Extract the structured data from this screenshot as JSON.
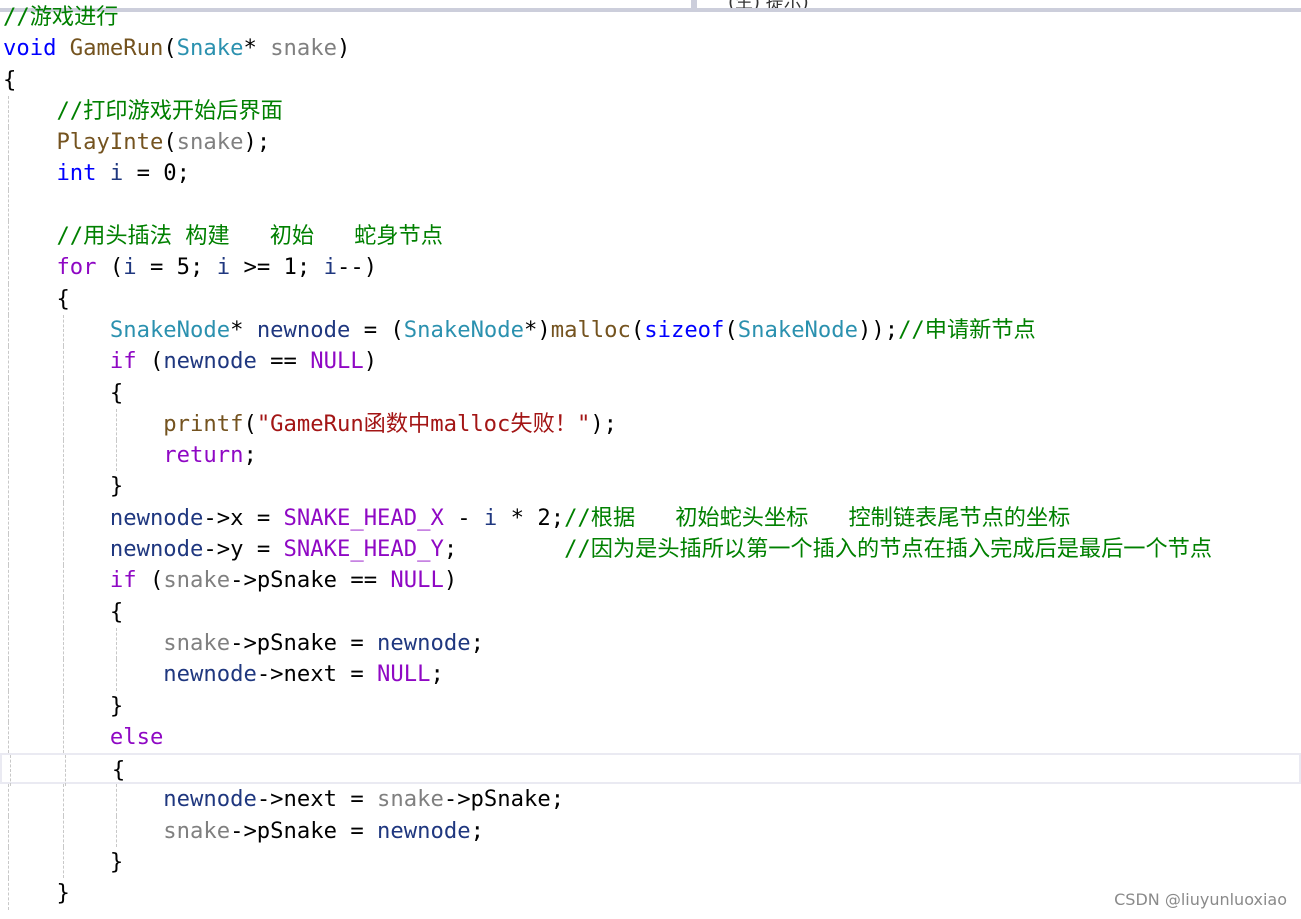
{
  "window": {
    "top_partial_text": "(生) 提示)"
  },
  "colors": {
    "keyword": "#0000ff",
    "control": "#8f08c4",
    "type": "#2b91af",
    "function": "#74531f",
    "parameter": "#808080",
    "local": "#1f377f",
    "comment": "#008000",
    "string": "#a31515"
  },
  "current_line": 24,
  "code": [
    {
      "indent": 0,
      "tokens": [
        [
          "//游戏进行",
          "c"
        ]
      ]
    },
    {
      "indent": 0,
      "tokens": [
        [
          "void",
          "k"
        ],
        [
          " ",
          "d"
        ],
        [
          "GameRun",
          "f"
        ],
        [
          "(",
          "d"
        ],
        [
          "Snake",
          "t"
        ],
        [
          "* ",
          "d"
        ],
        [
          "snake",
          "g"
        ],
        [
          ")",
          "d"
        ]
      ]
    },
    {
      "indent": 0,
      "tokens": [
        [
          "{",
          "d"
        ]
      ]
    },
    {
      "indent": 1,
      "tokens": [
        [
          "//打印游戏开始后界面",
          "c"
        ]
      ]
    },
    {
      "indent": 1,
      "tokens": [
        [
          "PlayInte",
          "f"
        ],
        [
          "(",
          "d"
        ],
        [
          "snake",
          "g"
        ],
        [
          ");",
          "d"
        ]
      ]
    },
    {
      "indent": 1,
      "tokens": [
        [
          "int",
          "k"
        ],
        [
          " ",
          "d"
        ],
        [
          "i",
          "v"
        ],
        [
          " = 0;",
          "d"
        ]
      ]
    },
    {
      "indent": 1,
      "tokens": []
    },
    {
      "indent": 1,
      "tokens": [
        [
          "//用头插法 构建   初始   蛇身节点",
          "c"
        ]
      ]
    },
    {
      "indent": 1,
      "tokens": [
        [
          "for",
          "p"
        ],
        [
          " (",
          "d"
        ],
        [
          "i",
          "v"
        ],
        [
          " = 5; ",
          "d"
        ],
        [
          "i",
          "v"
        ],
        [
          " >= 1; ",
          "d"
        ],
        [
          "i",
          "v"
        ],
        [
          "--)",
          "d"
        ]
      ]
    },
    {
      "indent": 1,
      "tokens": [
        [
          "{",
          "d"
        ]
      ]
    },
    {
      "indent": 2,
      "tokens": [
        [
          "SnakeNode",
          "t"
        ],
        [
          "* ",
          "d"
        ],
        [
          "newnode",
          "v"
        ],
        [
          " = (",
          "d"
        ],
        [
          "SnakeNode",
          "t"
        ],
        [
          "*)",
          "d"
        ],
        [
          "malloc",
          "f"
        ],
        [
          "(",
          "d"
        ],
        [
          "sizeof",
          "k"
        ],
        [
          "(",
          "d"
        ],
        [
          "SnakeNode",
          "t"
        ],
        [
          "));",
          "d"
        ],
        [
          "//申请新节点",
          "c"
        ]
      ]
    },
    {
      "indent": 2,
      "tokens": [
        [
          "if",
          "p"
        ],
        [
          " (",
          "d"
        ],
        [
          "newnode",
          "v"
        ],
        [
          " == ",
          "d"
        ],
        [
          "NULL",
          "p"
        ],
        [
          ")",
          "d"
        ]
      ]
    },
    {
      "indent": 2,
      "tokens": [
        [
          "{",
          "d"
        ]
      ]
    },
    {
      "indent": 3,
      "tokens": [
        [
          "printf",
          "f"
        ],
        [
          "(",
          "d"
        ],
        [
          "\"GameRun函数中malloc失败！\"",
          "s"
        ],
        [
          ");",
          "d"
        ]
      ]
    },
    {
      "indent": 3,
      "tokens": [
        [
          "return",
          "p"
        ],
        [
          ";",
          "d"
        ]
      ]
    },
    {
      "indent": 2,
      "tokens": [
        [
          "}",
          "d"
        ]
      ]
    },
    {
      "indent": 2,
      "tokens": [
        [
          "newnode",
          "v"
        ],
        [
          "->x = ",
          "d"
        ],
        [
          "SNAKE_HEAD_X",
          "p"
        ],
        [
          " - ",
          "d"
        ],
        [
          "i",
          "v"
        ],
        [
          " * 2;",
          "d"
        ],
        [
          "//根据   初始蛇头坐标   控制链表尾节点的坐标",
          "c"
        ]
      ]
    },
    {
      "indent": 2,
      "tokens": [
        [
          "newnode",
          "v"
        ],
        [
          "->y = ",
          "d"
        ],
        [
          "SNAKE_HEAD_Y",
          "p"
        ],
        [
          ";        ",
          "d"
        ],
        [
          "//因为是头插所以第一个插入的节点在插入完成后是最后一个节点",
          "c"
        ]
      ]
    },
    {
      "indent": 2,
      "tokens": [
        [
          "if",
          "p"
        ],
        [
          " (",
          "d"
        ],
        [
          "snake",
          "g"
        ],
        [
          "->pSnake == ",
          "d"
        ],
        [
          "NULL",
          "p"
        ],
        [
          ")",
          "d"
        ]
      ]
    },
    {
      "indent": 2,
      "tokens": [
        [
          "{",
          "d"
        ]
      ]
    },
    {
      "indent": 3,
      "tokens": [
        [
          "snake",
          "g"
        ],
        [
          "->pSnake = ",
          "d"
        ],
        [
          "newnode",
          "v"
        ],
        [
          ";",
          "d"
        ]
      ]
    },
    {
      "indent": 3,
      "tokens": [
        [
          "newnode",
          "v"
        ],
        [
          "->next = ",
          "d"
        ],
        [
          "NULL",
          "p"
        ],
        [
          ";",
          "d"
        ]
      ]
    },
    {
      "indent": 2,
      "tokens": [
        [
          "}",
          "d"
        ]
      ]
    },
    {
      "indent": 2,
      "tokens": [
        [
          "else",
          "p"
        ]
      ]
    },
    {
      "indent": 2,
      "tokens": [
        [
          "{",
          "d"
        ]
      ]
    },
    {
      "indent": 3,
      "tokens": [
        [
          "newnode",
          "v"
        ],
        [
          "->next = ",
          "d"
        ],
        [
          "snake",
          "g"
        ],
        [
          "->pSnake;",
          "d"
        ]
      ]
    },
    {
      "indent": 3,
      "tokens": [
        [
          "snake",
          "g"
        ],
        [
          "->pSnake = ",
          "d"
        ],
        [
          "newnode",
          "v"
        ],
        [
          ";",
          "d"
        ]
      ]
    },
    {
      "indent": 2,
      "tokens": [
        [
          "}",
          "d"
        ]
      ]
    },
    {
      "indent": 1,
      "tokens": [
        [
          "}",
          "d"
        ]
      ]
    }
  ],
  "watermark": "CSDN @liuyunluoxiao"
}
